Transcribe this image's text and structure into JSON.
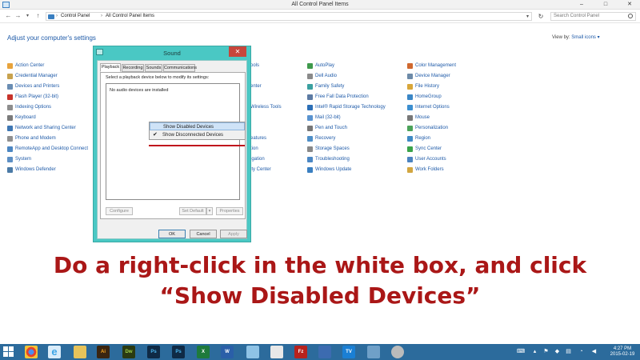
{
  "window": {
    "title": "All Control Panel Items",
    "minimize": "–",
    "maximize": "□",
    "close": "✕"
  },
  "address_bar": {
    "back": "←",
    "forward": "→",
    "history": "▾",
    "up": "↑",
    "crumbs": [
      "Control Panel",
      "All Control Panel Items"
    ],
    "separator": "›",
    "dropdown": "▾",
    "refresh": "↻",
    "search_placeholder": "Search Control Panel"
  },
  "main": {
    "heading": "Adjust your computer's settings",
    "view_by_label": "View by:",
    "view_by_value": "Small icons ▾"
  },
  "items": {
    "col1": [
      "Action Center",
      "Credential Manager",
      "Devices and Printers",
      "Flash Player (32-bit)",
      "Indexing Options",
      "Keyboard",
      "Network and Sharing Center",
      "Phone and Modem",
      "RemoteApp and Desktop Connect",
      "System",
      "Windows Defender"
    ],
    "col2": [
      "ools",
      "",
      "enter",
      "",
      "Wireless Tools",
      "",
      "",
      "eatures",
      "tion",
      "igation",
      "ity Center"
    ],
    "col3": [
      "AutoPlay",
      "Dell Audio",
      "Family Safety",
      "Free Fall Data Protection",
      "Intel® Rapid Storage Technology",
      "Mail (32-bit)",
      "Pen and Touch",
      "Recovery",
      "Storage Spaces",
      "Troubleshooting",
      "Windows Update"
    ],
    "col4": [
      "Color Management",
      "Device Manager",
      "File History",
      "HomeGroup",
      "Internet Options",
      "Mouse",
      "Personalization",
      "Region",
      "Sync Center",
      "User Accounts",
      "Work Folders"
    ]
  },
  "sound_dialog": {
    "title": "Sound",
    "close": "✕",
    "tabs": [
      "Playback",
      "Recording",
      "Sounds",
      "Communications"
    ],
    "instruction": "Select a playback device below to modify its settings:",
    "empty_message": "No audio devices are installed",
    "configure": "Configure",
    "set_default": "Set Default",
    "set_default_arrow": "▾",
    "properties": "Properties",
    "ok": "OK",
    "cancel": "Cancel",
    "apply": "Apply"
  },
  "context_menu": {
    "items": [
      "Show Disabled Devices",
      "Show Disconnected Devices"
    ],
    "check": "✔"
  },
  "caption": {
    "line1": "Do a right-click in the white box, and click",
    "line2": "“Show Disabled Devices”"
  },
  "taskbar": {
    "apps": [
      {
        "name": "chrome",
        "label": ""
      },
      {
        "name": "internet-explorer",
        "label": "e"
      },
      {
        "name": "file-explorer",
        "label": ""
      },
      {
        "name": "illustrator",
        "label": "Ai"
      },
      {
        "name": "dreamweaver",
        "label": "Dw"
      },
      {
        "name": "photoshop",
        "label": "Ps"
      },
      {
        "name": "photoshop-2",
        "label": "Ps"
      },
      {
        "name": "excel",
        "label": "X"
      },
      {
        "name": "word",
        "label": "W"
      },
      {
        "name": "app-1",
        "label": ""
      },
      {
        "name": "app-2",
        "label": ""
      },
      {
        "name": "filezilla",
        "label": "Fz"
      },
      {
        "name": "app-3",
        "label": ""
      },
      {
        "name": "teamviewer",
        "label": "TV"
      },
      {
        "name": "sound-control-panel",
        "label": ""
      }
    ],
    "time": "4:27 PM",
    "date": "2015-02-19"
  },
  "colors": {
    "link": "#1e5aa8",
    "dialog_frame": "#4ac8c4",
    "caption": "#aa1717",
    "taskbar": "#2c6b9c"
  }
}
